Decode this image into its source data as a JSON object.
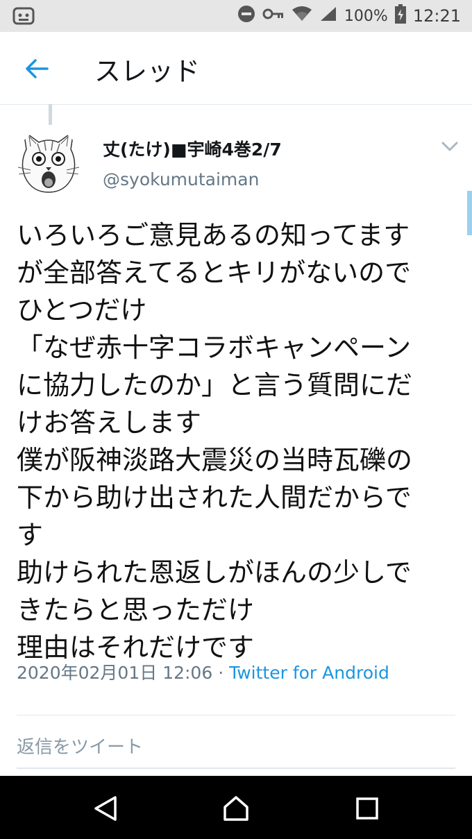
{
  "status_bar": {
    "battery": "100%",
    "time": "12:21",
    "icons": [
      "android-debug-icon",
      "do-not-disturb-icon",
      "key-icon",
      "wifi-icon",
      "signal-icon",
      "battery-charging-icon"
    ]
  },
  "header": {
    "title": "スレッド",
    "back_icon": "back-arrow-icon"
  },
  "tweet": {
    "display_name": "丈(たけ)■宇崎4巻2/7",
    "handle": "@syokumutaiman",
    "body": "いろいろご意見あるの知ってます\nが全部答えてるとキリがないので\nひとつだけ\n「なぜ赤十字コラボキャンペーン\nに協力したのか」と言う質問にだ\nけお答えします\n僕が阪神淡路大震災の当時瓦礫の\n下から助け出された人間だからで\nす\n助けられた恩返しがほんの少しで\nきたらと思っただけ\n理由はそれだけです",
    "timestamp": "2020年02月01日 12:06",
    "separator": " · ",
    "source": "Twitter for Android"
  },
  "reply": {
    "placeholder": "返信をツイート"
  },
  "navigation": {
    "icons": [
      "nav-back-icon",
      "nav-home-icon",
      "nav-recents-icon"
    ]
  },
  "colors": {
    "accent": "#1b95e0",
    "secondary_text": "#657786",
    "status_bar_bg": "#e6e6e6",
    "nav_bar_bg": "#000000"
  }
}
